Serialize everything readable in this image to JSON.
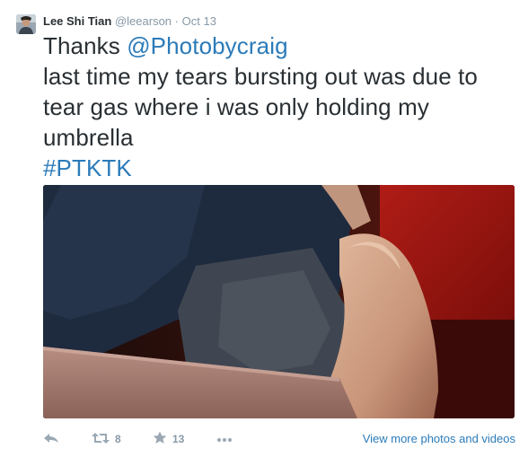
{
  "tweet": {
    "author": {
      "fullname": "Lee Shi Tian",
      "username": "@leearson",
      "separator": "·",
      "time": "Oct 13"
    },
    "text": {
      "line1_prefix": "Thanks ",
      "mention": "@Photobycraig",
      "line2": "last time my tears bursting out was due to",
      "line3": "tear gas where i was only holding my",
      "line4": "umbrella",
      "hashtag": "#PTKTK"
    },
    "media": {
      "icon": "photo"
    },
    "actions": {
      "reply_icon": "reply-icon",
      "retweet_icon": "retweet-icon",
      "retweet_count": "8",
      "favorite_icon": "star-icon",
      "favorite_count": "13",
      "more_icon": "more-icon",
      "view_more": "View more photos and videos"
    }
  },
  "colors": {
    "text": "#292f33",
    "meta": "#8899a6",
    "link": "#2b7bb9",
    "icon": "#9aa8b4"
  }
}
